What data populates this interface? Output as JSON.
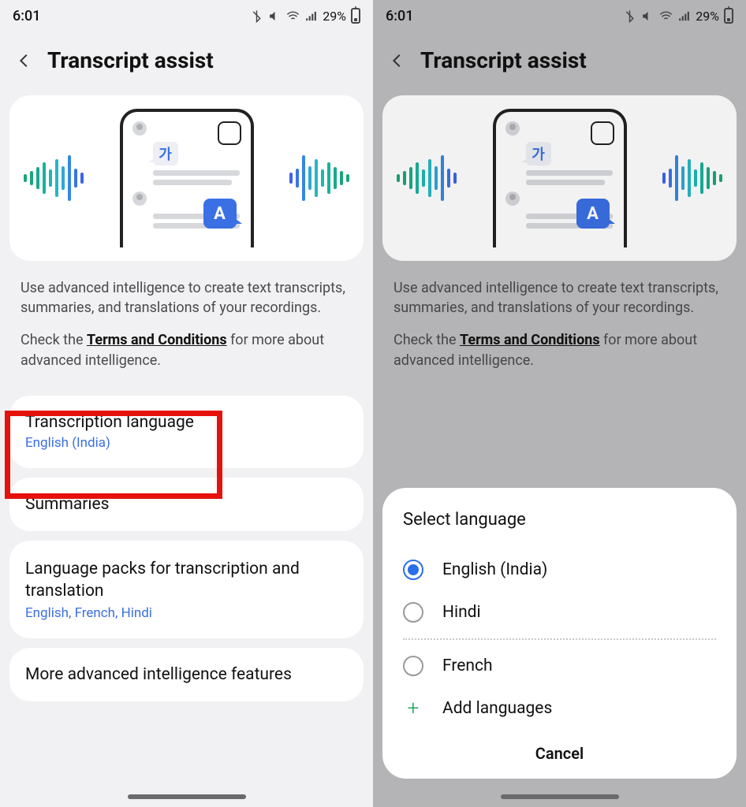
{
  "status": {
    "time": "6:01",
    "battery_percent": "29%"
  },
  "header": {
    "title": "Transcript assist"
  },
  "illustration": {
    "ga_label": "가",
    "a_label": "A"
  },
  "description": {
    "intro": "Use advanced intelligence to create text transcripts, summaries, and translations of your recordings.",
    "check_prefix": "Check the ",
    "terms_label": "Terms and Conditions",
    "check_suffix": " for more about advanced intelligence."
  },
  "settings": {
    "transcription": {
      "label": "Transcription language",
      "value": "English (India)"
    },
    "summaries": {
      "label": "Summaries"
    },
    "packs": {
      "label": "Language packs for transcription and translation",
      "value": "English, French, Hindi"
    },
    "more": {
      "label": "More advanced intelligence features"
    }
  },
  "sheet": {
    "title": "Select language",
    "options": [
      {
        "label": "English (India)",
        "checked": true
      },
      {
        "label": "Hindi",
        "checked": false
      },
      {
        "label": "French",
        "checked": false
      }
    ],
    "add_label": "Add languages",
    "cancel_label": "Cancel"
  }
}
